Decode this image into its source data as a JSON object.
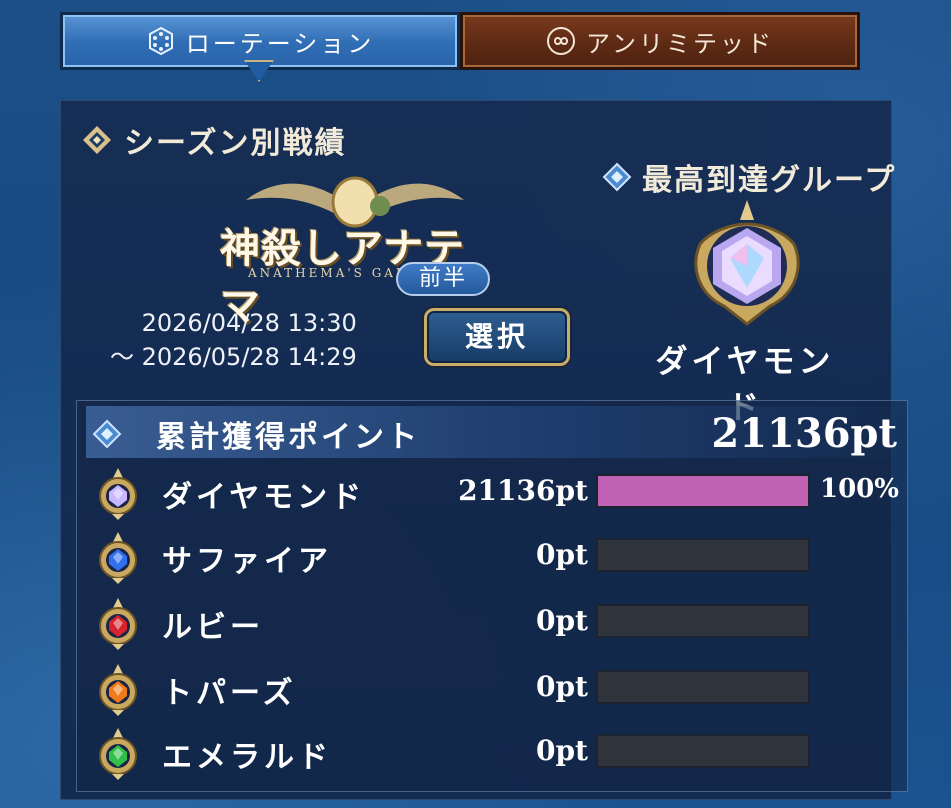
{
  "tabs": [
    {
      "label": "ローテーション",
      "icon": "rotation-icon",
      "active": true
    },
    {
      "label": "アンリミテッド",
      "icon": "infinity-icon",
      "active": false
    }
  ],
  "season": {
    "section_title": "シーズン別戦績",
    "logo_title": "神殺しアナテマ",
    "logo_subtitle": "ANATHEMA'S GAMB",
    "half_label": "前半",
    "start": "2026/04/28 13:30",
    "end": "～ 2026/05/28 14:29",
    "select_label": "選択"
  },
  "best_group": {
    "title": "最高到達グループ",
    "name": "ダイヤモンド",
    "icon": "diamond-rank-emblem"
  },
  "points": {
    "title": "累計獲得ポイント",
    "total": "21136pt",
    "ranks": [
      {
        "name": "ダイヤモンド",
        "pt": "21136pt",
        "pct": "100%",
        "fill": 1.0,
        "icon": "diamond-gem-icon",
        "gem": "#c9b8ff"
      },
      {
        "name": "サファイア",
        "pt": "0pt",
        "pct": "",
        "fill": 0,
        "icon": "sapphire-gem-icon",
        "gem": "#2f6ff0"
      },
      {
        "name": "ルビー",
        "pt": "0pt",
        "pct": "",
        "fill": 0,
        "icon": "ruby-gem-icon",
        "gem": "#d8232e"
      },
      {
        "name": "トパーズ",
        "pt": "0pt",
        "pct": "",
        "fill": 0,
        "icon": "topaz-gem-icon",
        "gem": "#f07a18"
      },
      {
        "name": "エメラルド",
        "pt": "0pt",
        "pct": "",
        "fill": 0,
        "icon": "emerald-gem-icon",
        "gem": "#2fbf4a"
      }
    ]
  },
  "colors": {
    "bar_fill": "#c061b4",
    "bar_empty": "#2f343c",
    "gold": "#c9ad6c"
  }
}
